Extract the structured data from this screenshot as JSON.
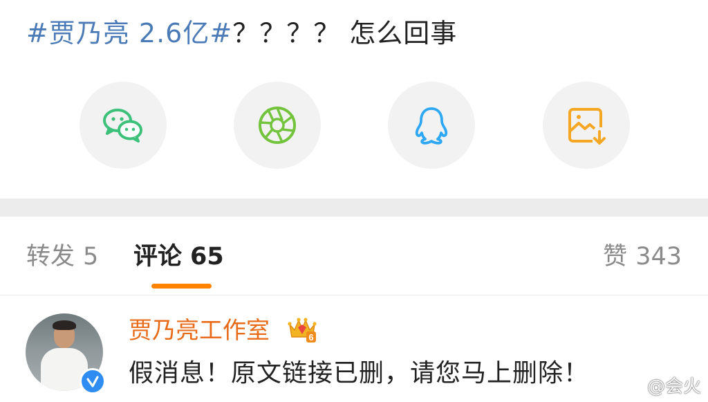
{
  "post": {
    "hashtag": "#贾乃亮 2.6亿#",
    "text": "？？？？ 怎么回事"
  },
  "share": {
    "items": [
      {
        "icon": "wechat-icon",
        "color": "#3dc07a"
      },
      {
        "icon": "moments-icon",
        "color": "#73c43c"
      },
      {
        "icon": "qq-icon",
        "color": "#2ea7f5"
      },
      {
        "icon": "save-image-icon",
        "color": "#f5a623"
      }
    ]
  },
  "tabs": {
    "repost_label": "转发",
    "repost_count": "5",
    "comment_label": "评论",
    "comment_count": "65",
    "likes_label": "赞",
    "likes_count": "343",
    "active_color": "#ff8200"
  },
  "comment": {
    "author": "贾乃亮工作室",
    "author_color": "#e86b1a",
    "badge_level": "6",
    "text": "假消息！原文链接已删，请您马上删除！"
  },
  "watermark": {
    "text": "@会火"
  }
}
